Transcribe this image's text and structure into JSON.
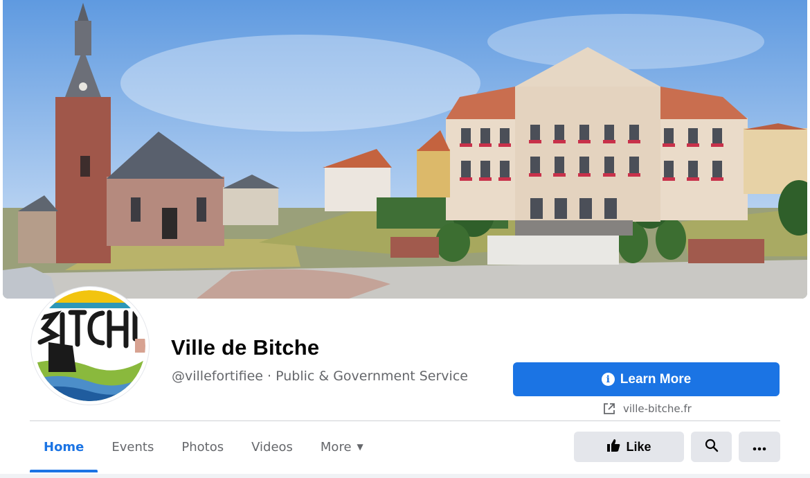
{
  "page": {
    "name": "Ville de Bitche",
    "handle_category": "@villefortifiee · Public & Government Service",
    "profile_logo_text": "BITCHE"
  },
  "actions": {
    "learn_more_label": "Learn More",
    "website": "ville-bitche.fr",
    "like_label": "Like"
  },
  "tabs": [
    {
      "label": "Home",
      "active": true
    },
    {
      "label": "Events",
      "active": false
    },
    {
      "label": "Photos",
      "active": false
    },
    {
      "label": "Videos",
      "active": false
    },
    {
      "label": "More",
      "active": false
    }
  ],
  "colors": {
    "accent": "#1b74e4",
    "button_gray": "#e4e6eb",
    "secondary_text": "#65676b"
  },
  "icons": [
    "info-icon",
    "external-link-icon",
    "thumbs-up-icon",
    "search-icon",
    "more-dots-icon",
    "caret-down-icon"
  ]
}
